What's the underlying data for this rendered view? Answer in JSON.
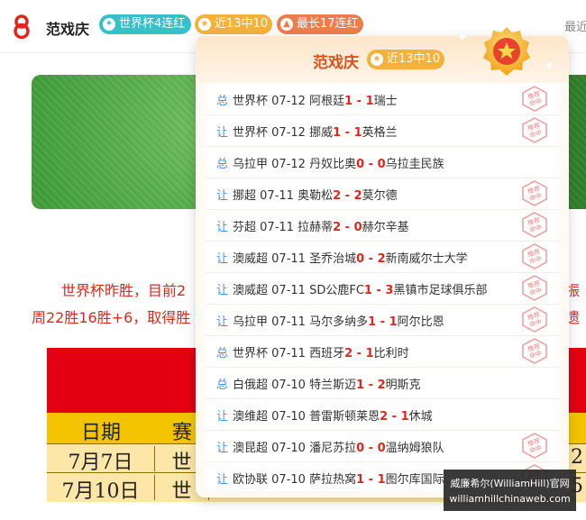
{
  "header": {
    "author": "范戏庆",
    "badges": {
      "worldcup": "世界杯4连红",
      "recent": "近13中10",
      "streak": "最长17连红"
    },
    "more_label": "最近"
  },
  "article": {
    "line1": "世界杯昨胜，目前2",
    "line1_right": "振",
    "line2": "周22胜16胜+6，取得胜",
    "line2_right": "遗"
  },
  "table": {
    "headers": [
      "日期",
      "赛"
    ],
    "rows": [
      [
        "7月7日",
        "世",
        "2"
      ],
      [
        "7月10日",
        "世",
        "5"
      ]
    ]
  },
  "popup": {
    "name": "范戏庆",
    "badge": "近13中10",
    "stamp_text": "推荐命中",
    "matches": [
      {
        "type": "总",
        "league": "世界杯",
        "date": "07-12",
        "home": "阿根廷",
        "hs": "1",
        "as": "1",
        "away": "瑞士",
        "hit": true
      },
      {
        "type": "让",
        "league": "世界杯",
        "date": "07-12",
        "home": "挪威",
        "hs": "1",
        "as": "1",
        "away": "英格兰",
        "hit": true
      },
      {
        "type": "总",
        "league": "乌拉甲",
        "date": "07-12",
        "home": "丹奴比奥",
        "hs": "0",
        "as": "0",
        "away": "乌拉圭民族",
        "hit": false
      },
      {
        "type": "让",
        "league": "挪超",
        "date": "07-11",
        "home": "奥勒松",
        "hs": "2",
        "as": "2",
        "away": "莫尔德",
        "hit": true
      },
      {
        "type": "让",
        "league": "芬超",
        "date": "07-11",
        "home": "拉赫蒂",
        "hs": "2",
        "as": "0",
        "away": "赫尔辛基",
        "hit": true
      },
      {
        "type": "让",
        "league": "澳威超",
        "date": "07-11",
        "home": "圣乔治城",
        "hs": "0",
        "as": "2",
        "away": "新南威尔士大学",
        "hit": true
      },
      {
        "type": "让",
        "league": "澳威超",
        "date": "07-11",
        "home": "SD公鹿FC",
        "hs": "1",
        "as": "3",
        "away": "黑镇市足球俱乐部",
        "hit": true
      },
      {
        "type": "让",
        "league": "乌拉甲",
        "date": "07-11",
        "home": "马尔多纳多",
        "hs": "1",
        "as": "1",
        "away": "阿尔比恩",
        "hit": true
      },
      {
        "type": "总",
        "league": "世界杯",
        "date": "07-11",
        "home": "西班牙",
        "hs": "2",
        "as": "1",
        "away": "比利时",
        "hit": true
      },
      {
        "type": "总",
        "league": "白俄超",
        "date": "07-10",
        "home": "特兰斯迈",
        "hs": "1",
        "as": "2",
        "away": "明斯克",
        "hit": false
      },
      {
        "type": "让",
        "league": "澳维超",
        "date": "07-10",
        "home": "普雷斯顿莱恩",
        "hs": "2",
        "as": "1",
        "away": "休城",
        "hit": false
      },
      {
        "type": "让",
        "league": "澳昆超",
        "date": "07-10",
        "home": "潘尼苏拉",
        "hs": "0",
        "as": "0",
        "away": "温纳姆狼队",
        "hit": true
      },
      {
        "type": "让",
        "league": "欧协联",
        "date": "07-10",
        "home": "萨拉热窝",
        "hs": "1",
        "as": "1",
        "away": "图尔库国际",
        "hit": true
      }
    ]
  },
  "watermark": {
    "line1": "威廉希尔(WilliamHill)官网",
    "line2": "williamhillchinaweb.com"
  },
  "colors": {
    "accent_red": "#e1251b",
    "teal": "#35c1c8",
    "gold": "#f6b13b",
    "orange": "#f07c4a",
    "type_blue": "#4a90e2"
  }
}
